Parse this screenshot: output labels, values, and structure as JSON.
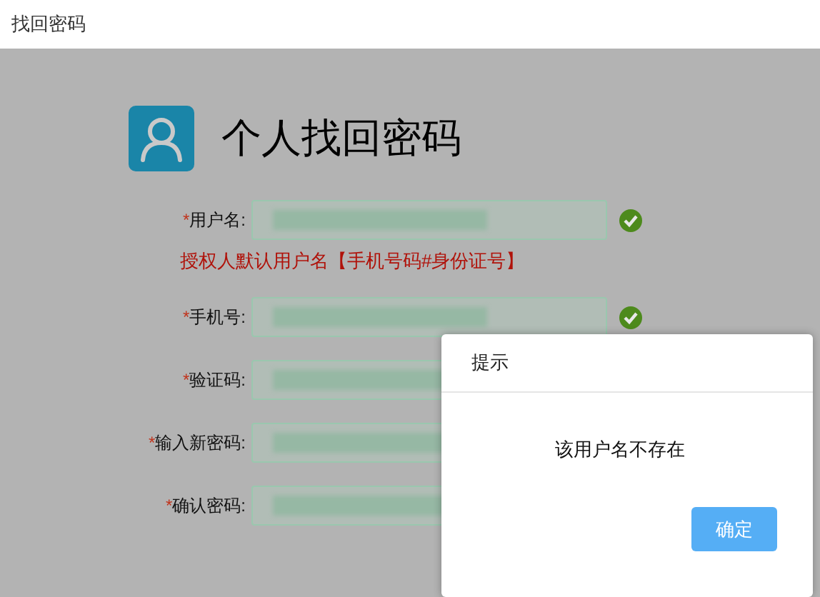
{
  "window": {
    "title": "找回密码"
  },
  "page": {
    "heading": "个人找回密码"
  },
  "form": {
    "fields": [
      {
        "required_mark": "*",
        "label": "用户名:",
        "filled": true,
        "valid": true,
        "hint": "授权人默认用户名【手机号码#身份证号】"
      },
      {
        "required_mark": "*",
        "label": "手机号:",
        "filled": true,
        "valid": true
      },
      {
        "required_mark": "*",
        "label": "验证码:",
        "filled": true
      },
      {
        "required_mark": "*",
        "label": "输入新密码:",
        "filled": true
      },
      {
        "required_mark": "*",
        "label": "确认密码:",
        "filled": true
      }
    ]
  },
  "dialog": {
    "title": "提示",
    "message": "该用户名不存在",
    "buttons": [
      {
        "label": "确定",
        "kind": "primary"
      }
    ]
  }
}
